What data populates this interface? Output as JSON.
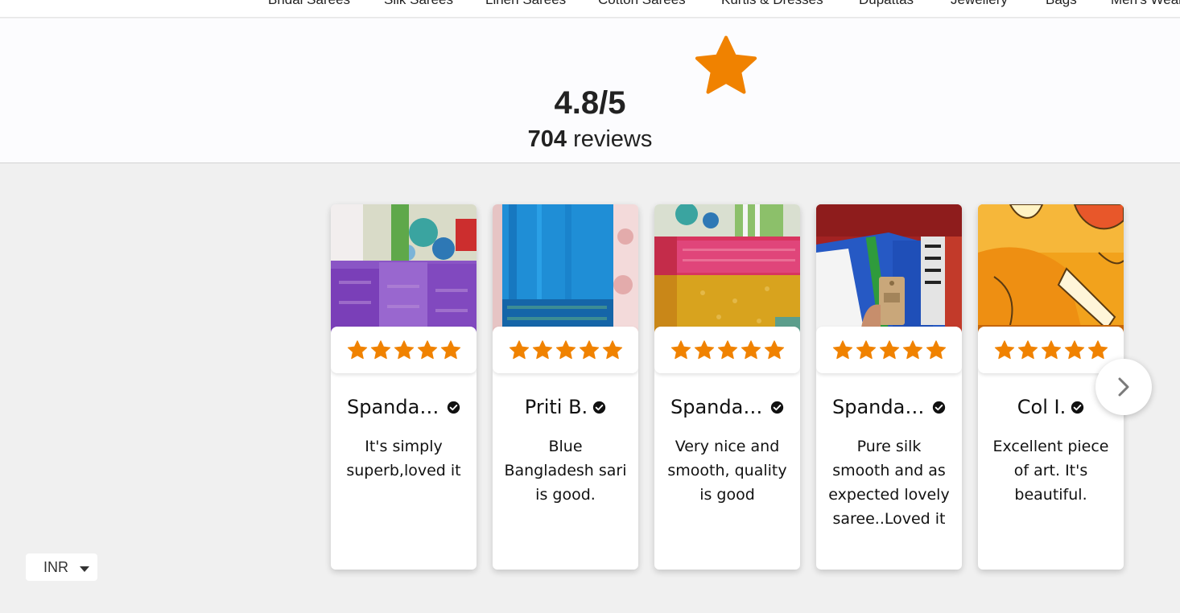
{
  "nav": {
    "items": [
      "Bridal Sarees",
      "Silk Sarees",
      "Linen Sarees",
      "Cotton Sarees",
      "Kurtis & Dresses",
      "Dupattas",
      "Jewellery",
      "Bags",
      "Men's Wear"
    ]
  },
  "summary": {
    "score": "4.8/5",
    "count": "704",
    "count_suffix": " reviews",
    "star_color": "#F08200"
  },
  "reviews": [
    {
      "name": "Spandana Parvathaneni",
      "rating": 5,
      "text": "It's simply superb,loved it",
      "photo": "purple-silk-saree-photo"
    },
    {
      "name": "Priti B.",
      "rating": 5,
      "text": "Blue Bangladesh sari is good.",
      "photo": "blue-saree-photo"
    },
    {
      "name": "Spandana Parvathaneni",
      "rating": 5,
      "text": "Very nice and smooth, quality is good",
      "photo": "mustard-pink-saree-photo"
    },
    {
      "name": "Spandana Parvathaneni",
      "rating": 5,
      "text": "Pure silk smooth and as expected lovely saree..Loved it",
      "photo": "printed-saree-with-tag-photo"
    },
    {
      "name": "Col I.",
      "rating": 5,
      "text": "Excellent piece of art. It's beautiful.",
      "photo": "painted-yellow-saree-photo"
    }
  ],
  "currency": {
    "selected": "INR"
  },
  "icons": {
    "next": "chevron-right-icon",
    "verified": "check-circle-icon",
    "star": "star-icon"
  }
}
